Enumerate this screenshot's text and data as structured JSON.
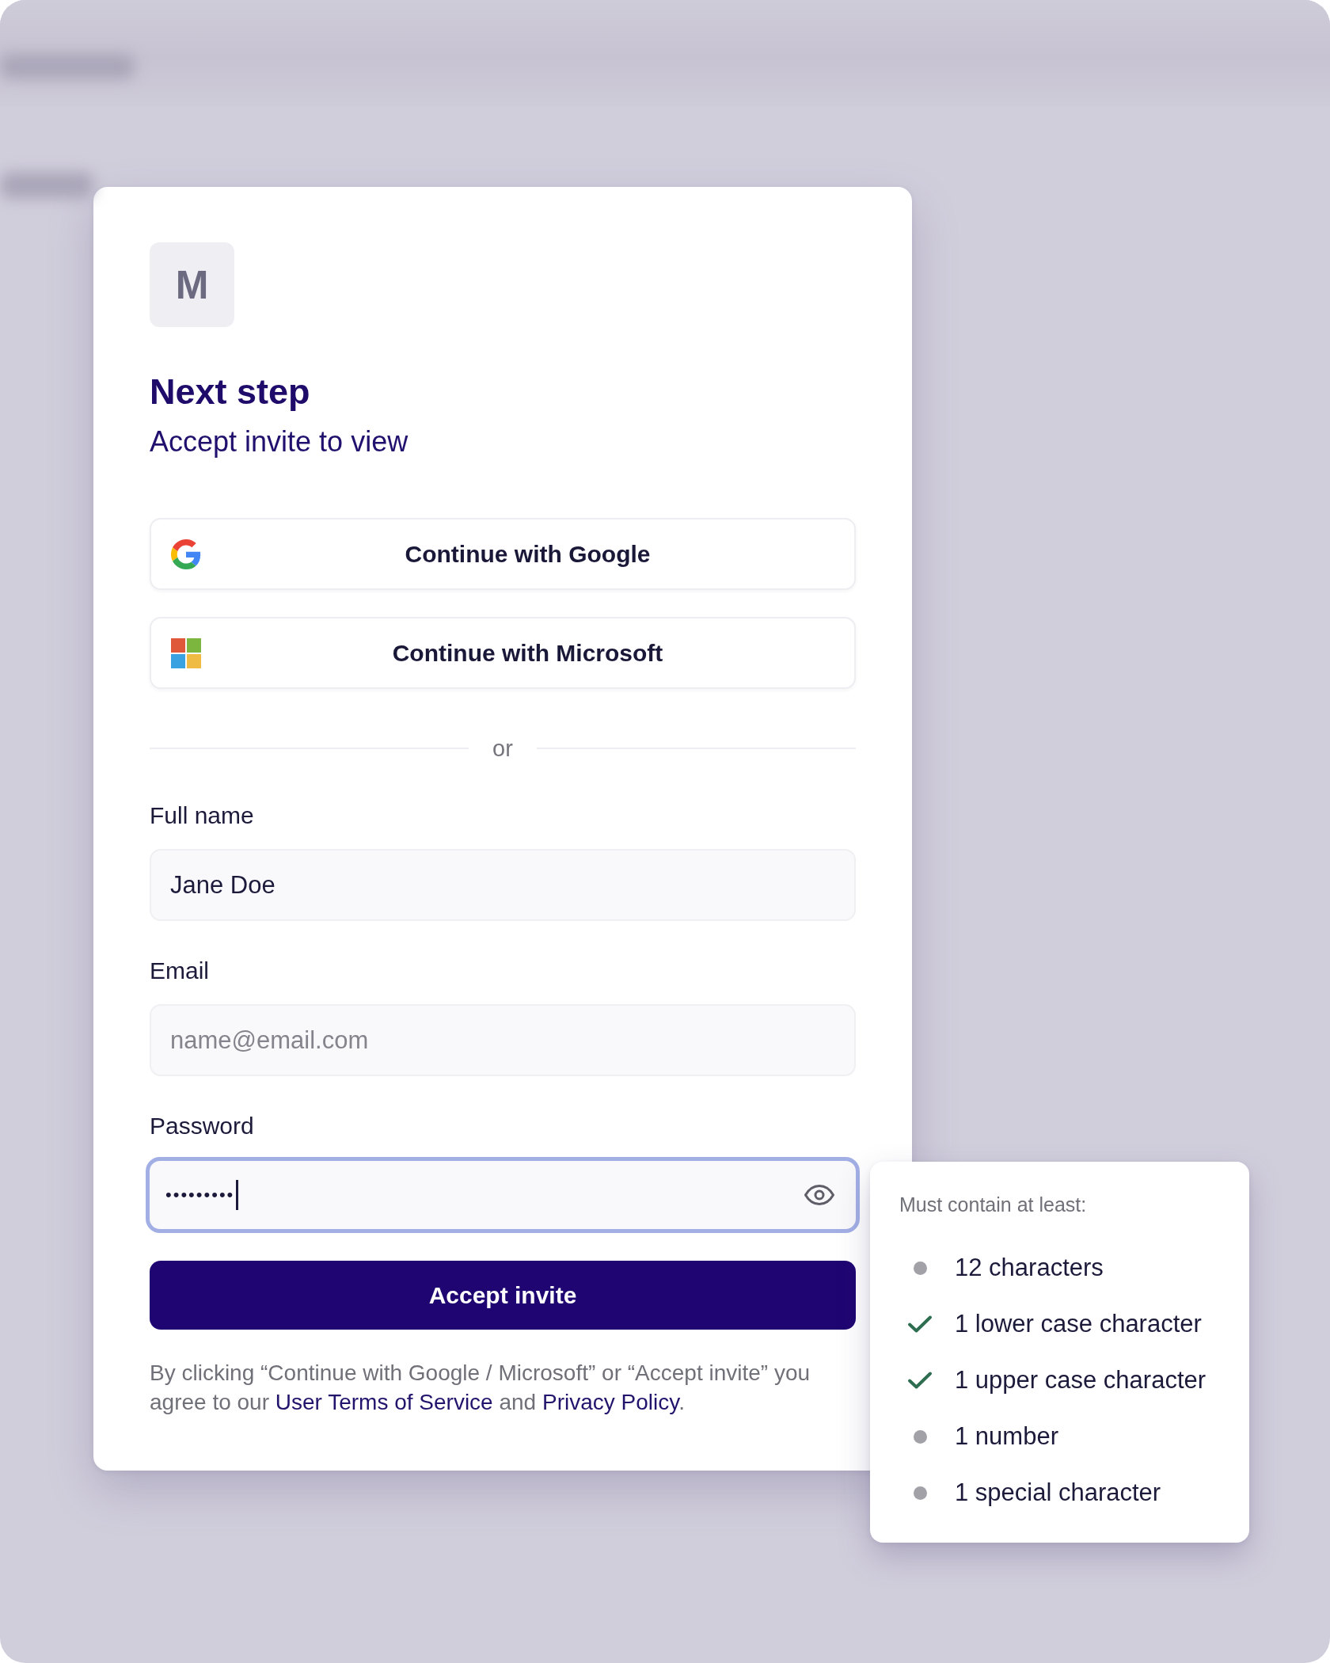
{
  "logo": {
    "letter": "M"
  },
  "title": "Next step",
  "subtitle": "Accept invite to view",
  "sso_buttons": [
    {
      "kind": "google",
      "label": "Continue with Google"
    },
    {
      "kind": "microsoft",
      "label": "Continue with Microsoft"
    }
  ],
  "divider": "or",
  "fields": [
    {
      "kind": "text",
      "label": "Full name",
      "value": "Jane Doe",
      "focused": false
    },
    {
      "kind": "text",
      "label": "Email",
      "placeholder": "name@email.com",
      "focused": false
    },
    {
      "kind": "password",
      "label": "Password",
      "value": "•••••••••",
      "focused": true
    }
  ],
  "submit_button": "Accept invite",
  "legal_text": [
    {
      "kind": "text",
      "text": "By clicking “Continue with Google / Microsoft” or “Accept invite” you agree to our "
    },
    {
      "kind": "link",
      "text": "User Terms of Service"
    },
    {
      "kind": "text",
      "text": " and "
    },
    {
      "kind": "link",
      "text": "Privacy Policy"
    },
    {
      "kind": "text",
      "text": "."
    }
  ],
  "password_rules": {
    "title": "Must contain at least:",
    "items": [
      {
        "label": "12 characters",
        "met": false
      },
      {
        "label": "1 lower case character",
        "met": true
      },
      {
        "label": "1 upper case character",
        "met": true
      },
      {
        "label": "1 number",
        "met": false
      },
      {
        "label": "1 special character",
        "met": false
      }
    ]
  }
}
